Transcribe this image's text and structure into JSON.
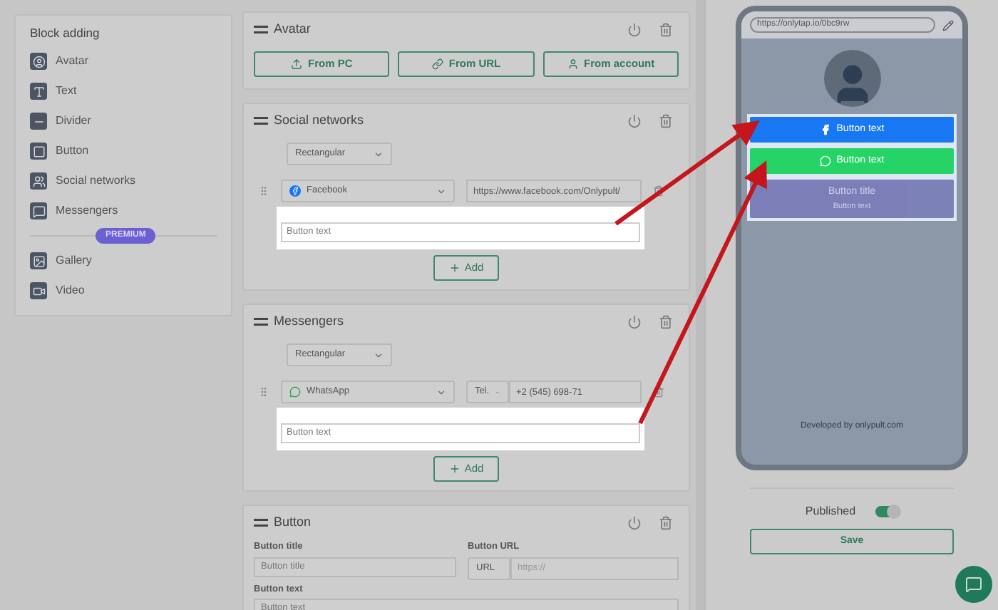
{
  "block_adding": {
    "title": "Block adding",
    "items": [
      {
        "kind": "avatar",
        "label": "Avatar"
      },
      {
        "kind": "text",
        "label": "Text"
      },
      {
        "kind": "divider",
        "label": "Divider"
      },
      {
        "kind": "button",
        "label": "Button"
      },
      {
        "kind": "social",
        "label": "Social networks"
      },
      {
        "kind": "messengers",
        "label": "Messengers"
      }
    ],
    "premium_badge": "PREMIUM",
    "premium_items": [
      {
        "kind": "gallery",
        "label": "Gallery"
      },
      {
        "kind": "video",
        "label": "Video"
      }
    ]
  },
  "avatar_card": {
    "title": "Avatar",
    "buttons": [
      {
        "kind": "upload",
        "label": "From PC"
      },
      {
        "kind": "link",
        "label": "From URL"
      },
      {
        "kind": "account",
        "label": "From account"
      }
    ]
  },
  "social_card": {
    "title": "Social networks",
    "style_select": "Rectangular",
    "network_select": "Facebook",
    "url_value": "https://www.facebook.com/Onlypult/",
    "button_text_placeholder": "Button text",
    "add_button": "Add"
  },
  "messengers_card": {
    "title": "Messengers",
    "style_select": "Rectangular",
    "messenger_select": "WhatsApp",
    "type_select": "Tel.",
    "phone_value": "+2 (545) 698-71",
    "button_text_placeholder": "Button text",
    "add_button": "Add"
  },
  "button_card": {
    "title": "Button",
    "title_label": "Button title",
    "title_placeholder": "Button title",
    "url_label": "Button URL",
    "url_type_select": "URL",
    "url_placeholder": "https://",
    "text_label": "Button text",
    "text_value": "Button text"
  },
  "preview": {
    "address": "https://onlytap.io/0bc9rw",
    "buttons": [
      {
        "kind": "facebook",
        "label": "Button text"
      },
      {
        "kind": "whatsapp",
        "label": "Button text"
      },
      {
        "kind": "custom",
        "label": "Button title",
        "sublabel": "Button text"
      }
    ],
    "footer": "Developed by onlypult.com"
  },
  "published": {
    "label": "Published",
    "on": true
  },
  "save_button": "Save"
}
